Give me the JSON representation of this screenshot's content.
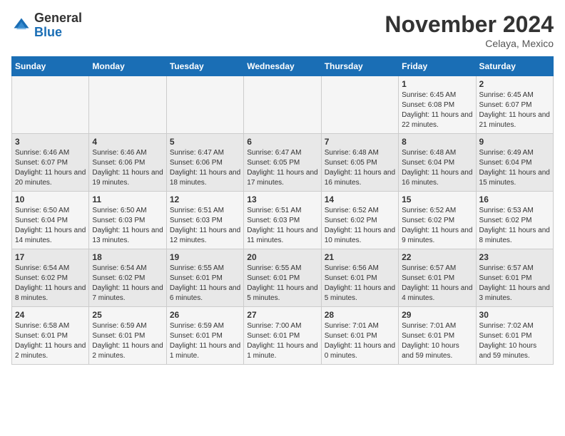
{
  "logo": {
    "general": "General",
    "blue": "Blue"
  },
  "title": "November 2024",
  "location": "Celaya, Mexico",
  "weekdays": [
    "Sunday",
    "Monday",
    "Tuesday",
    "Wednesday",
    "Thursday",
    "Friday",
    "Saturday"
  ],
  "weeks": [
    [
      {
        "day": "",
        "sunrise": "",
        "sunset": "",
        "daylight": ""
      },
      {
        "day": "",
        "sunrise": "",
        "sunset": "",
        "daylight": ""
      },
      {
        "day": "",
        "sunrise": "",
        "sunset": "",
        "daylight": ""
      },
      {
        "day": "",
        "sunrise": "",
        "sunset": "",
        "daylight": ""
      },
      {
        "day": "",
        "sunrise": "",
        "sunset": "",
        "daylight": ""
      },
      {
        "day": "1",
        "sunrise": "Sunrise: 6:45 AM",
        "sunset": "Sunset: 6:08 PM",
        "daylight": "Daylight: 11 hours and 22 minutes."
      },
      {
        "day": "2",
        "sunrise": "Sunrise: 6:45 AM",
        "sunset": "Sunset: 6:07 PM",
        "daylight": "Daylight: 11 hours and 21 minutes."
      }
    ],
    [
      {
        "day": "3",
        "sunrise": "Sunrise: 6:46 AM",
        "sunset": "Sunset: 6:07 PM",
        "daylight": "Daylight: 11 hours and 20 minutes."
      },
      {
        "day": "4",
        "sunrise": "Sunrise: 6:46 AM",
        "sunset": "Sunset: 6:06 PM",
        "daylight": "Daylight: 11 hours and 19 minutes."
      },
      {
        "day": "5",
        "sunrise": "Sunrise: 6:47 AM",
        "sunset": "Sunset: 6:06 PM",
        "daylight": "Daylight: 11 hours and 18 minutes."
      },
      {
        "day": "6",
        "sunrise": "Sunrise: 6:47 AM",
        "sunset": "Sunset: 6:05 PM",
        "daylight": "Daylight: 11 hours and 17 minutes."
      },
      {
        "day": "7",
        "sunrise": "Sunrise: 6:48 AM",
        "sunset": "Sunset: 6:05 PM",
        "daylight": "Daylight: 11 hours and 16 minutes."
      },
      {
        "day": "8",
        "sunrise": "Sunrise: 6:48 AM",
        "sunset": "Sunset: 6:04 PM",
        "daylight": "Daylight: 11 hours and 16 minutes."
      },
      {
        "day": "9",
        "sunrise": "Sunrise: 6:49 AM",
        "sunset": "Sunset: 6:04 PM",
        "daylight": "Daylight: 11 hours and 15 minutes."
      }
    ],
    [
      {
        "day": "10",
        "sunrise": "Sunrise: 6:50 AM",
        "sunset": "Sunset: 6:04 PM",
        "daylight": "Daylight: 11 hours and 14 minutes."
      },
      {
        "day": "11",
        "sunrise": "Sunrise: 6:50 AM",
        "sunset": "Sunset: 6:03 PM",
        "daylight": "Daylight: 11 hours and 13 minutes."
      },
      {
        "day": "12",
        "sunrise": "Sunrise: 6:51 AM",
        "sunset": "Sunset: 6:03 PM",
        "daylight": "Daylight: 11 hours and 12 minutes."
      },
      {
        "day": "13",
        "sunrise": "Sunrise: 6:51 AM",
        "sunset": "Sunset: 6:03 PM",
        "daylight": "Daylight: 11 hours and 11 minutes."
      },
      {
        "day": "14",
        "sunrise": "Sunrise: 6:52 AM",
        "sunset": "Sunset: 6:02 PM",
        "daylight": "Daylight: 11 hours and 10 minutes."
      },
      {
        "day": "15",
        "sunrise": "Sunrise: 6:52 AM",
        "sunset": "Sunset: 6:02 PM",
        "daylight": "Daylight: 11 hours and 9 minutes."
      },
      {
        "day": "16",
        "sunrise": "Sunrise: 6:53 AM",
        "sunset": "Sunset: 6:02 PM",
        "daylight": "Daylight: 11 hours and 8 minutes."
      }
    ],
    [
      {
        "day": "17",
        "sunrise": "Sunrise: 6:54 AM",
        "sunset": "Sunset: 6:02 PM",
        "daylight": "Daylight: 11 hours and 8 minutes."
      },
      {
        "day": "18",
        "sunrise": "Sunrise: 6:54 AM",
        "sunset": "Sunset: 6:02 PM",
        "daylight": "Daylight: 11 hours and 7 minutes."
      },
      {
        "day": "19",
        "sunrise": "Sunrise: 6:55 AM",
        "sunset": "Sunset: 6:01 PM",
        "daylight": "Daylight: 11 hours and 6 minutes."
      },
      {
        "day": "20",
        "sunrise": "Sunrise: 6:55 AM",
        "sunset": "Sunset: 6:01 PM",
        "daylight": "Daylight: 11 hours and 5 minutes."
      },
      {
        "day": "21",
        "sunrise": "Sunrise: 6:56 AM",
        "sunset": "Sunset: 6:01 PM",
        "daylight": "Daylight: 11 hours and 5 minutes."
      },
      {
        "day": "22",
        "sunrise": "Sunrise: 6:57 AM",
        "sunset": "Sunset: 6:01 PM",
        "daylight": "Daylight: 11 hours and 4 minutes."
      },
      {
        "day": "23",
        "sunrise": "Sunrise: 6:57 AM",
        "sunset": "Sunset: 6:01 PM",
        "daylight": "Daylight: 11 hours and 3 minutes."
      }
    ],
    [
      {
        "day": "24",
        "sunrise": "Sunrise: 6:58 AM",
        "sunset": "Sunset: 6:01 PM",
        "daylight": "Daylight: 11 hours and 2 minutes."
      },
      {
        "day": "25",
        "sunrise": "Sunrise: 6:59 AM",
        "sunset": "Sunset: 6:01 PM",
        "daylight": "Daylight: 11 hours and 2 minutes."
      },
      {
        "day": "26",
        "sunrise": "Sunrise: 6:59 AM",
        "sunset": "Sunset: 6:01 PM",
        "daylight": "Daylight: 11 hours and 1 minute."
      },
      {
        "day": "27",
        "sunrise": "Sunrise: 7:00 AM",
        "sunset": "Sunset: 6:01 PM",
        "daylight": "Daylight: 11 hours and 1 minute."
      },
      {
        "day": "28",
        "sunrise": "Sunrise: 7:01 AM",
        "sunset": "Sunset: 6:01 PM",
        "daylight": "Daylight: 11 hours and 0 minutes."
      },
      {
        "day": "29",
        "sunrise": "Sunrise: 7:01 AM",
        "sunset": "Sunset: 6:01 PM",
        "daylight": "Daylight: 10 hours and 59 minutes."
      },
      {
        "day": "30",
        "sunrise": "Sunrise: 7:02 AM",
        "sunset": "Sunset: 6:01 PM",
        "daylight": "Daylight: 10 hours and 59 minutes."
      }
    ]
  ]
}
